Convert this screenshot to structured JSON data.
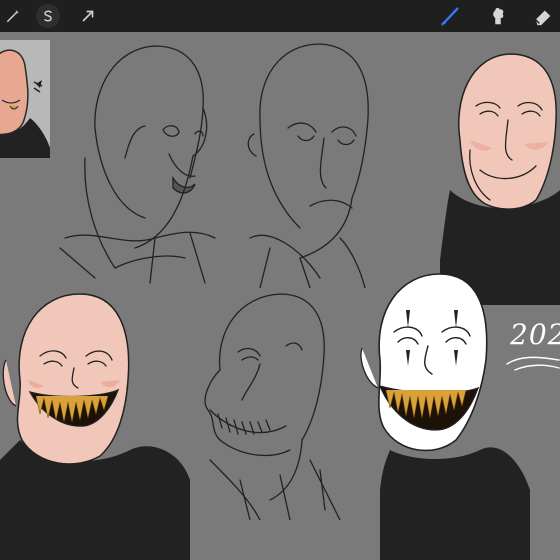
{
  "toolbar": {
    "left_buttons": [
      "magic-wand-icon",
      "selection-s-icon",
      "transform-arrow-icon"
    ],
    "right_tools": [
      "brush-icon",
      "smudge-icon",
      "eraser-icon"
    ],
    "active_tool": "brush-icon",
    "accent_color": "#2f7cf6",
    "bar_color": "#1f1f1f"
  },
  "canvas": {
    "background_color": "#7a7a7a",
    "signature_text": "202",
    "sketches": [
      "sketch-bald-man-pouting",
      "sketch-bald-man-frowning",
      "sketch-colored-man-smirking",
      "sketch-colored-man-grinning-teeth",
      "sketch-line-man-grinning",
      "sketch-clown-makeup-grinning"
    ]
  },
  "reference_window": {
    "visible": true
  }
}
